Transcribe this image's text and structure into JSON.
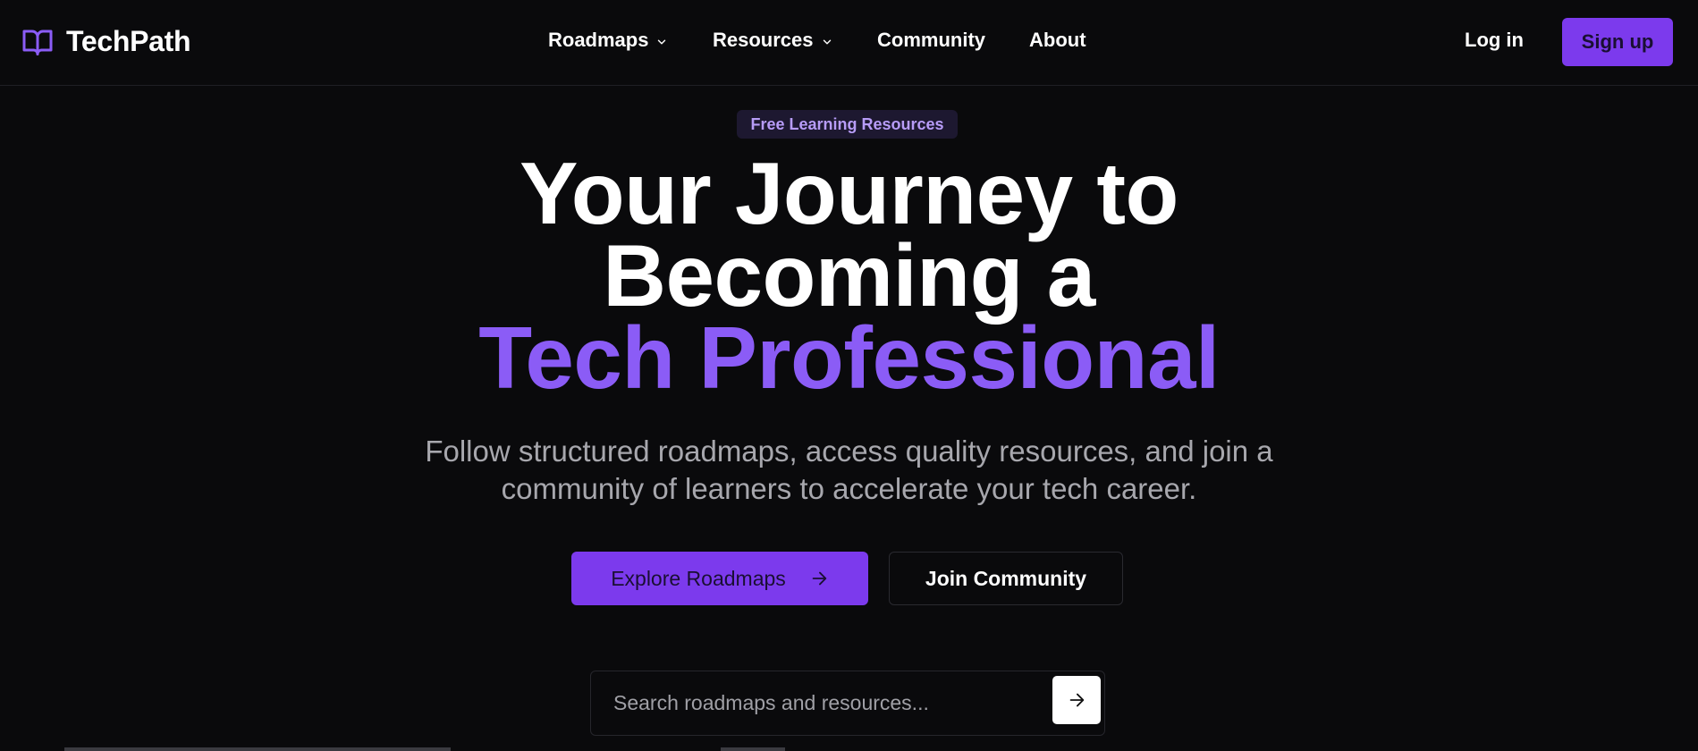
{
  "brand": {
    "name": "TechPath",
    "icon": "book-open-icon",
    "icon_color": "#8b5cf6"
  },
  "nav": {
    "links": [
      {
        "label": "Roadmaps",
        "has_dropdown": true
      },
      {
        "label": "Resources",
        "has_dropdown": true
      },
      {
        "label": "Community",
        "has_dropdown": false
      },
      {
        "label": "About",
        "has_dropdown": false
      }
    ],
    "login_label": "Log in",
    "signup_label": "Sign up"
  },
  "hero": {
    "badge": "Free Learning Resources",
    "headline_line1": "Your Journey to",
    "headline_line2": "Becoming a",
    "headline_accent": "Tech Professional",
    "subtitle_line1": "Follow structured roadmaps, access quality resources, and join a",
    "subtitle_line2": "community of learners to accelerate your tech career.",
    "primary_cta": "Explore Roadmaps",
    "secondary_cta": "Join Community"
  },
  "search": {
    "placeholder": "Search roadmaps and resources...",
    "value": "",
    "submit_icon": "arrow-right-icon"
  },
  "colors": {
    "background": "#0a0a0c",
    "accent": "#7c3aed",
    "accent_text": "#8b5cf6",
    "muted_text": "#a7a7ad"
  }
}
